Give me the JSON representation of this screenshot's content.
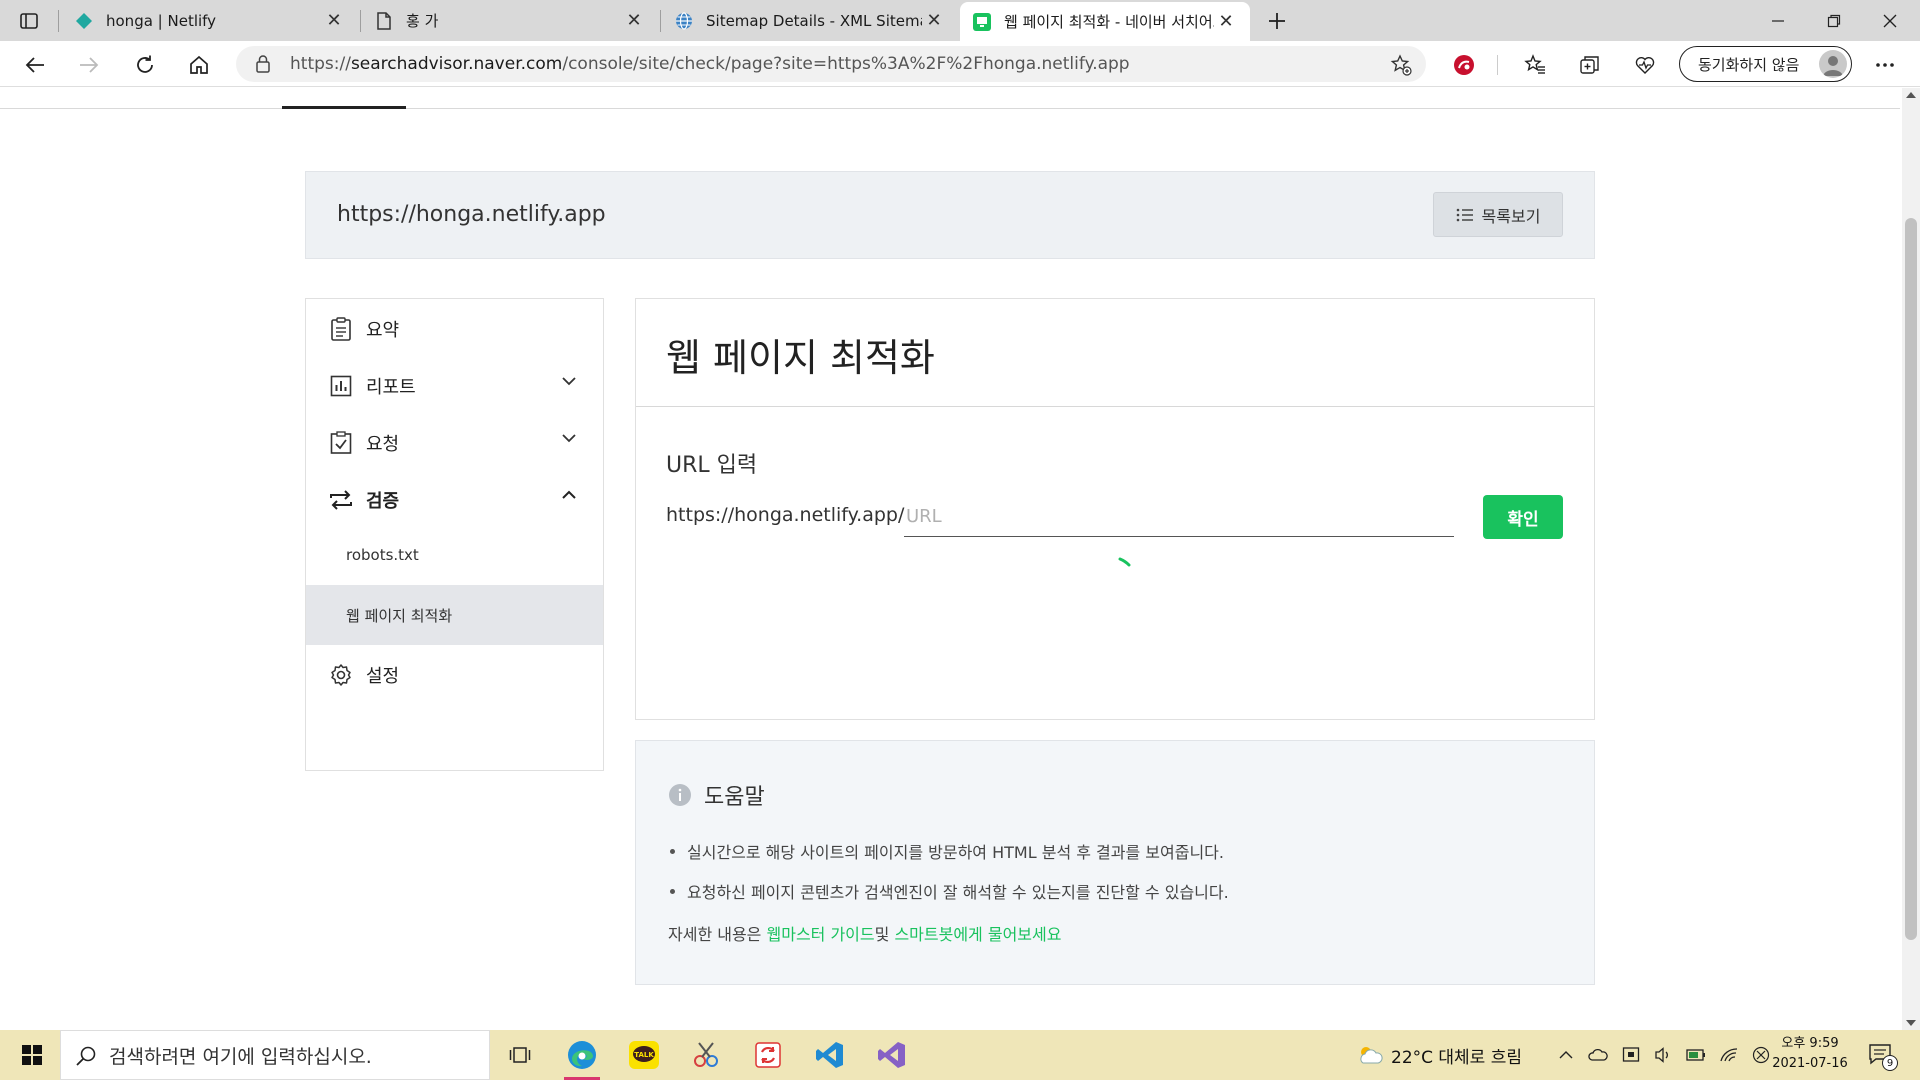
{
  "browser": {
    "tabs": [
      {
        "title": "honga | Netlify",
        "icon": "netlify-icon"
      },
      {
        "title": "홍 가",
        "icon": "document-icon"
      },
      {
        "title": "Sitemap Details - XML Sitemaps",
        "icon": "globe-icon"
      },
      {
        "title": "웹 페이지 최적화 - 네이버 서치어드",
        "icon": "naver-searchadvisor-icon",
        "active": true
      }
    ],
    "url_prefix": "https://",
    "url_domain": "searchadvisor.naver.com",
    "url_path": "/console/site/check/page?site=https%3A%2F%2Fhonga.netlify.app",
    "sync_label": "동기화하지 않음"
  },
  "site": {
    "url": "https://honga.netlify.app",
    "list_button": "목록보기"
  },
  "sidebar": {
    "items": [
      {
        "label": "요약",
        "icon": "clipboard-icon"
      },
      {
        "label": "리포트",
        "icon": "bar-chart-icon"
      },
      {
        "label": "요청",
        "icon": "checkbox-icon"
      },
      {
        "label": "검증",
        "icon": "repeat-arrows-icon"
      },
      {
        "label": "설정",
        "icon": "gear-icon"
      }
    ],
    "subitems": [
      {
        "label": "robots.txt"
      },
      {
        "label": "웹 페이지 최적화",
        "selected": true
      }
    ]
  },
  "main": {
    "title": "웹 페이지 최적화",
    "input_label": "URL 입력",
    "url_prefix": "https://honga.netlify.app/",
    "input_placeholder": "URL",
    "input_value": "",
    "confirm_button": "확인"
  },
  "help": {
    "title": "도움말",
    "bullets": [
      "실시간으로 해당 사이트의 페이지를 방문하여 HTML 분석 후 결과를 보여줍니다.",
      "요청하신 페이지 콘텐츠가 검색엔진이 잘 해석할 수 있는지를 진단할 수 있습니다."
    ],
    "more_prefix": "자세한 내용은 ",
    "more_link1": "웹마스터 가이드",
    "more_middle": "및 ",
    "more_link2": "스마트봇에게 물어보세요"
  },
  "taskbar": {
    "search_placeholder": "검색하려면 여기에 입력하십시오.",
    "weather": "22°C  대체로 흐림",
    "time": "오후 9:59",
    "date": "2021-07-16",
    "notification_count": "9"
  },
  "colors": {
    "accent_green": "#19c25e",
    "taskbar_bg": "#efe6b8"
  }
}
